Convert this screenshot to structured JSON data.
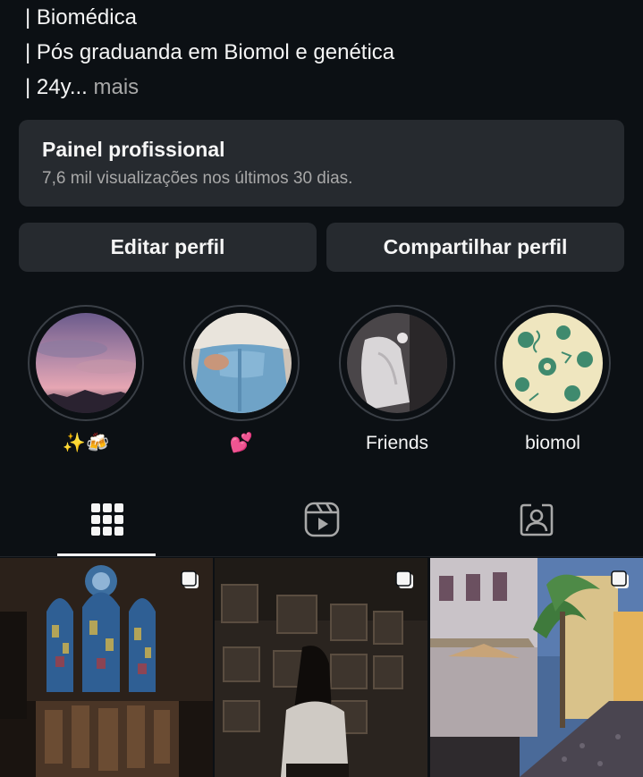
{
  "bio": {
    "lines": [
      "| Biomédica",
      "| Pós graduanda em Biomol e genética",
      "| 24y..."
    ],
    "more_label": "mais"
  },
  "panel": {
    "title": "Painel profissional",
    "subtitle": "7,6 mil visualizações nos últimos 30 dias."
  },
  "buttons": {
    "edit": "Editar perfil",
    "share": "Compartilhar perfil"
  },
  "highlights": [
    {
      "label": "✨🍻"
    },
    {
      "label": "💕"
    },
    {
      "label": "Friends"
    },
    {
      "label": "biomol"
    }
  ],
  "tabs": [
    {
      "icon": "grid-icon",
      "active": true
    },
    {
      "icon": "reels-icon",
      "active": false
    },
    {
      "icon": "tagged-icon",
      "active": false
    }
  ],
  "colors": {
    "background": "#0c1014",
    "card": "#262a2f",
    "text": "#f5f5f5",
    "muted": "#a8a8a8"
  }
}
